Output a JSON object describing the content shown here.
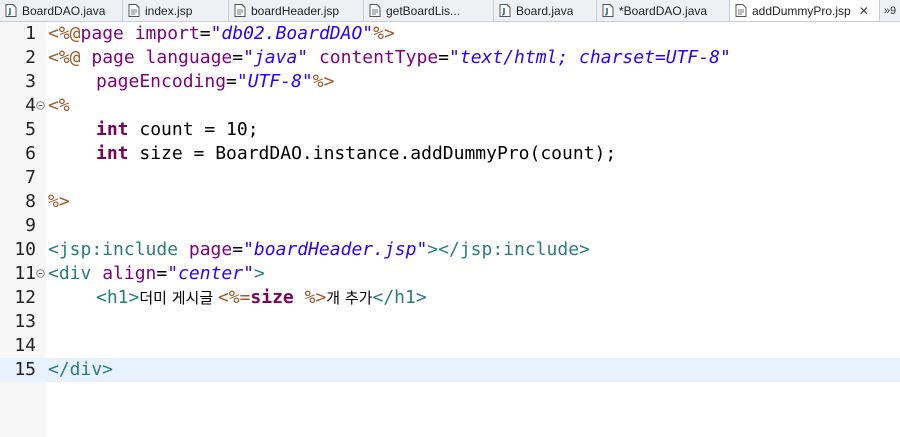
{
  "tabs": [
    {
      "label": "BoardDAO.java",
      "icon": "java-file-icon",
      "active": false
    },
    {
      "label": "index.jsp",
      "icon": "jsp-file-icon",
      "active": false
    },
    {
      "label": "boardHeader.jsp",
      "icon": "jsp-file-icon",
      "active": false
    },
    {
      "label": "getBoardLis...",
      "icon": "jsp-file-icon",
      "active": false
    },
    {
      "label": "Board.java",
      "icon": "java-file-icon",
      "active": false
    },
    {
      "label": "*BoardDAO.java",
      "icon": "java-file-icon",
      "active": false
    },
    {
      "label": "addDummyPro.jsp",
      "icon": "jsp-file-icon",
      "active": true
    }
  ],
  "tab_close": "✕",
  "tab_overflow": "»9",
  "code": {
    "l1": {
      "num": "1",
      "a": "<%@",
      "b": "page ",
      "c": "import",
      "d": "=",
      "e": "\"db02.BoardDAO\"",
      "f": "%>"
    },
    "l2": {
      "num": "2",
      "a": "<%@",
      "b": " page ",
      "c": "language",
      "d": "=",
      "e": "\"java\"",
      "g": " contentType",
      "h": "=",
      "i": "\"text/html; charset=UTF-8\""
    },
    "l3": {
      "num": "3",
      "c": "pageEncoding",
      "d": "=",
      "e": "\"UTF-8\"",
      "f": "%>"
    },
    "l4": {
      "num": "4",
      "a": "<%"
    },
    "l5": {
      "num": "5",
      "k": "int",
      "t": " count = 10;"
    },
    "l6": {
      "num": "6",
      "k": "int",
      "t": " size = BoardDAO.instance.addDummyPro(count);"
    },
    "l7": {
      "num": "7"
    },
    "l8": {
      "num": "8",
      "a": "%>"
    },
    "l9": {
      "num": "9"
    },
    "l10": {
      "num": "10",
      "o": "<jsp:include",
      "c": " page",
      "d": "=",
      "e": "\"boardHeader.jsp\"",
      "x": "></jsp:include>"
    },
    "l11": {
      "num": "11",
      "o": "<div",
      "c": " align",
      "d": "=",
      "e": "\"center\"",
      "x": ">"
    },
    "l12": {
      "num": "12",
      "o": "<h1>",
      "t1": "더미 게시글 ",
      "j1": "<%=",
      "t2": "size ",
      "j2": "%>",
      "t3": "개 추가",
      "x": "</h1>"
    },
    "l13": {
      "num": "13"
    },
    "l14": {
      "num": "14"
    },
    "l15": {
      "num": "15",
      "o": "</div>"
    }
  },
  "colors": {
    "jsp_delimiter": "#a05a2c",
    "keyword": "#7f0055",
    "tag": "#2a7d7f",
    "attribute": "#7f007f",
    "string": "#2a00ff",
    "current_line": "#e8f2fe"
  }
}
